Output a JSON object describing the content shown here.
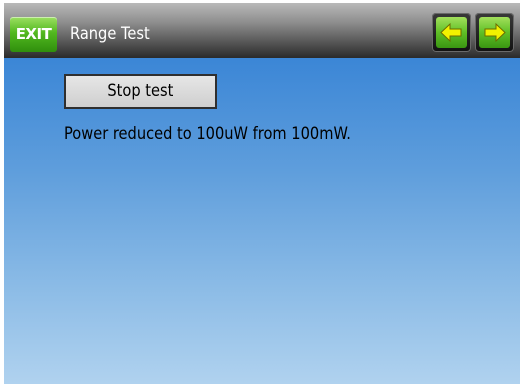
{
  "header": {
    "exit_label": "EXIT",
    "title": "Range Test",
    "back_icon": "arrow-left-icon",
    "forward_icon": "arrow-right-icon"
  },
  "main": {
    "stop_button_label": "Stop test",
    "status_message": "Power reduced to 100uW from 100mW."
  },
  "colors": {
    "accent_green": "#52b81f",
    "header_dark": "#2a2a2a",
    "background_blue": "#3b86d6"
  }
}
